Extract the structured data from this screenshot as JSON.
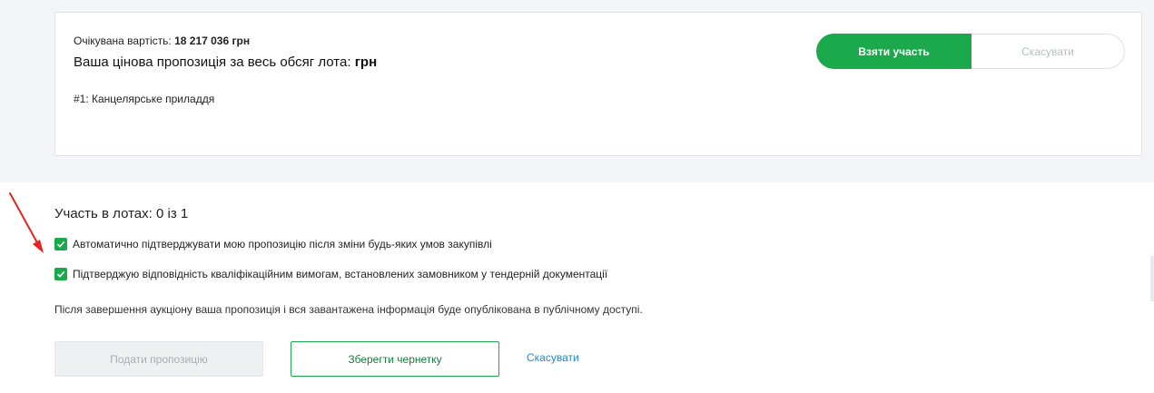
{
  "lot_card": {
    "expected_cost_label": "Очікувана вартість: ",
    "expected_cost_value": "18 217 036 грн",
    "price_offer_label": "Ваша цінова пропозиція за весь обсяг лота: ",
    "price_offer_currency": "грн",
    "lot_name": "#1: Канцелярське приладдя",
    "participate_button": "Взяти участь",
    "cancel_button": "Скасувати"
  },
  "participation": {
    "summary": "Участь в лотах: 0 із 1",
    "checkboxes": [
      {
        "label": "Автоматично підтверджувати мою пропозицію після зміни будь-яких умов закупівлі",
        "checked": true
      },
      {
        "label": "Підтверджую відповідність кваліфікаційним вимогам, встановлених замовником у тендерній документації",
        "checked": true
      }
    ],
    "notice": "Після завершення аукціону ваша пропозиція і вся завантажена інформація буде опублікована в публічному доступі."
  },
  "actions": {
    "submit_button": "Подати пропозицію",
    "save_draft_button": "Зберегти чернетку",
    "cancel_link": "Скасувати"
  },
  "colors": {
    "accent_green": "#1ba94c",
    "link_blue": "#2a86c5",
    "annotation_arrow": "#e8231f"
  }
}
